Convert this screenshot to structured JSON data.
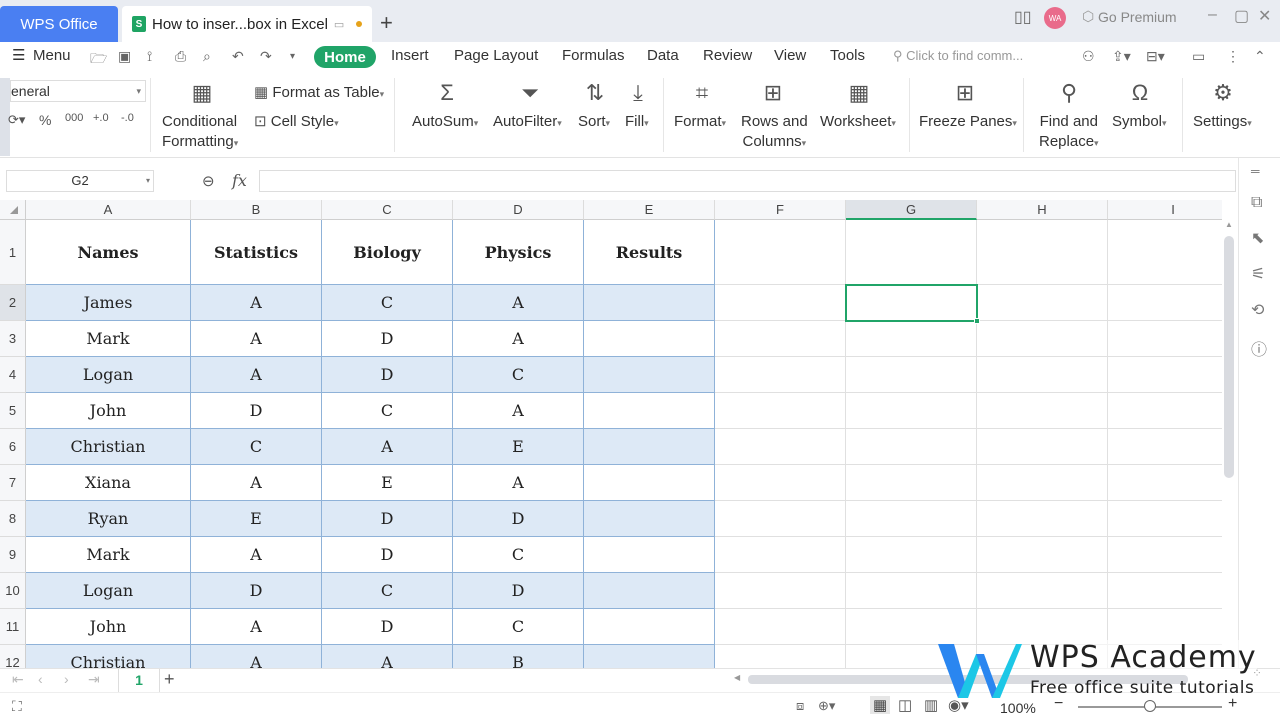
{
  "titlebar": {
    "app_tab": "WPS Office",
    "doc_tab": "How to inser...box in Excel",
    "new_tab_icon": "+",
    "avatar": "WA",
    "go_premium": "Go Premium"
  },
  "menubar": {
    "menu": "Menu",
    "tabs": [
      "Home",
      "Insert",
      "Page Layout",
      "Formulas",
      "Data",
      "Review",
      "View",
      "Tools"
    ],
    "search_placeholder": "Click to find comm..."
  },
  "ribbon": {
    "number_format": "eneral",
    "conditional_formatting": [
      "Conditional",
      "Formatting"
    ],
    "format_as_table": "Format as Table",
    "cell_style": "Cell Style",
    "autosum": "AutoSum",
    "autofilter": "AutoFilter",
    "sort": "Sort",
    "fill": "Fill",
    "format": "Format",
    "rows_and_columns": [
      "Rows and",
      "Columns"
    ],
    "worksheet": "Worksheet",
    "freeze_panes": "Freeze Panes",
    "find_and_replace": [
      "Find and",
      "Replace"
    ],
    "symbol": "Symbol",
    "settings": "Settings"
  },
  "formula_bar": {
    "name_box": "G2",
    "fx": "fx",
    "formula": ""
  },
  "grid": {
    "columns": [
      "A",
      "B",
      "C",
      "D",
      "E",
      "F",
      "G",
      "H",
      "I"
    ],
    "rows": [
      "1",
      "2",
      "3",
      "4",
      "5",
      "6",
      "7",
      "8",
      "9",
      "10",
      "11",
      "12"
    ],
    "headers": [
      "Names",
      "Statistics",
      "Biology",
      "Physics",
      "Results"
    ],
    "data": [
      [
        "James",
        "A",
        "C",
        "A",
        ""
      ],
      [
        "Mark",
        "A",
        "D",
        "A",
        ""
      ],
      [
        "Logan",
        "A",
        "D",
        "C",
        ""
      ],
      [
        "John",
        "D",
        "C",
        "A",
        ""
      ],
      [
        "Christian",
        "C",
        "A",
        "E",
        ""
      ],
      [
        "Xiana",
        "A",
        "E",
        "A",
        ""
      ],
      [
        "Ryan",
        "E",
        "D",
        "D",
        ""
      ],
      [
        "Mark",
        "A",
        "D",
        "C",
        ""
      ],
      [
        "Logan",
        "D",
        "C",
        "D",
        ""
      ],
      [
        "John",
        "A",
        "D",
        "C",
        ""
      ],
      [
        "Christian",
        "A",
        "A",
        "B",
        ""
      ]
    ],
    "selected_cell": "G2"
  },
  "sheets": {
    "active": "1"
  },
  "status": {
    "zoom": "100%",
    "zoom_level": 0.5
  },
  "watermark": {
    "title": "WPS Academy",
    "subtitle": "Free office suite tutorials"
  },
  "colors": {
    "accent": "#20a468",
    "app_tab": "#4a7ff2",
    "table_band": "#dde9f6"
  }
}
